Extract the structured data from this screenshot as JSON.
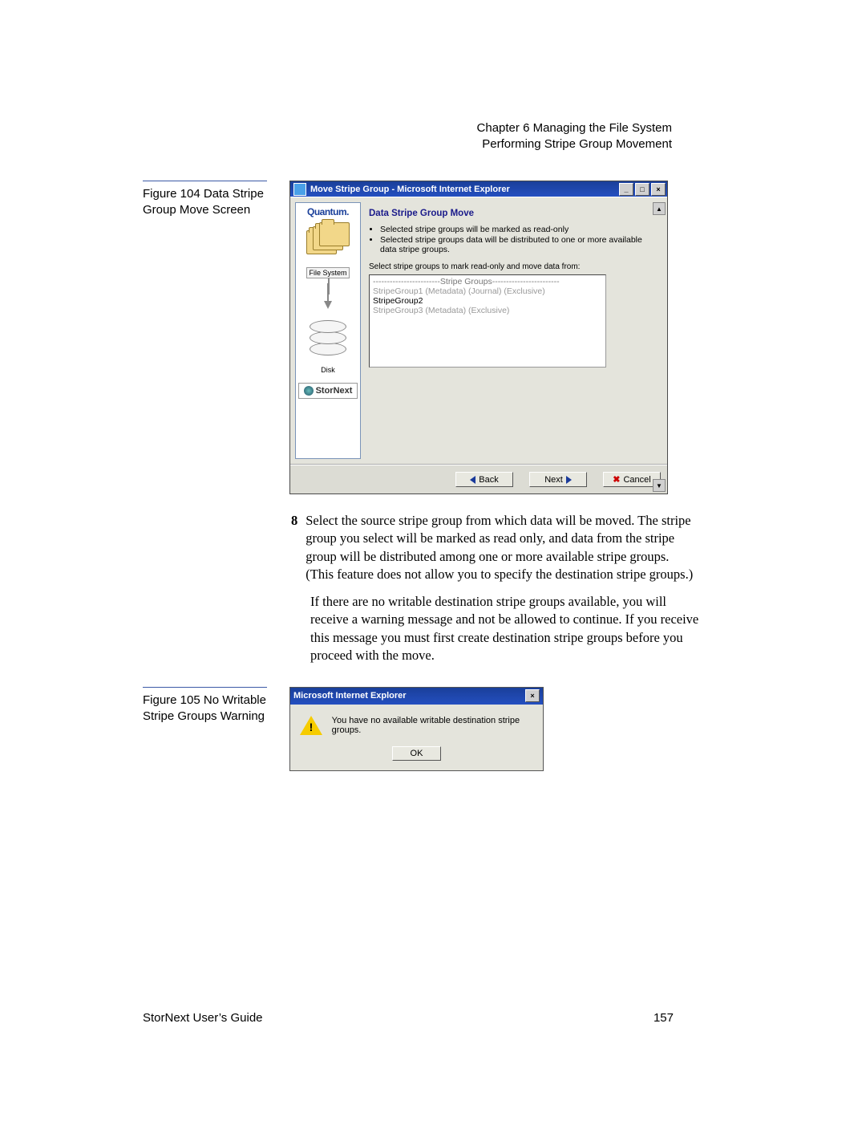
{
  "header": {
    "chapter": "Chapter 6  Managing the File System",
    "section": "Performing Stripe Group Movement"
  },
  "figure1": {
    "label": "Figure 104  Data Stripe Group Move Screen",
    "window_title": "Move Stripe Group - Microsoft Internet Explorer",
    "sidebar": {
      "brand": "Quantum.",
      "fs_label": "File System",
      "disk_label": "Disk",
      "product": "StorNext"
    },
    "content": {
      "heading": "Data Stripe Group Move",
      "bullet1": "Selected stripe groups will be marked as read-only",
      "bullet2": "Selected stripe groups data will be distributed to one or more available data stripe groups.",
      "instruction": "Select stripe groups to mark read-only and move data from:",
      "list_header": "------------------------Stripe Groups------------------------",
      "item1": "StripeGroup1 (Metadata) (Journal) (Exclusive)",
      "item2": "StripeGroup2",
      "item3": "StripeGroup3 (Metadata) (Exclusive)"
    },
    "buttons": {
      "back": "Back",
      "next": "Next",
      "cancel": "Cancel"
    }
  },
  "body": {
    "step_num": "8",
    "step_text": "Select the source stripe group from which data will be moved. The stripe group you select will be marked as read only, and data from the stripe group will be distributed among one or more available stripe groups. (This feature does not allow you to specify the destination stripe groups.)",
    "para2": "If there are no writable destination stripe groups available, you will receive a warning message and not be allowed to continue. If you receive this message you must first create destination stripe groups before you proceed with the move."
  },
  "figure2": {
    "label": "Figure 105   No Writable Stripe Groups Warning",
    "title": "Microsoft Internet Explorer",
    "message": "You have no available writable destination stripe groups.",
    "ok": "OK"
  },
  "footer": {
    "left": "StorNext User’s Guide",
    "right": "157"
  }
}
